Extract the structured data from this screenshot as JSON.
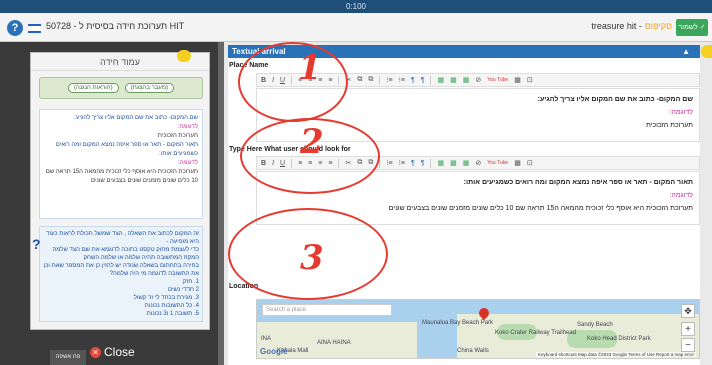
{
  "topbar": {
    "label": "0:100"
  },
  "header": {
    "title": "HIT תערוכת חידה בסיסית ל - 50728",
    "right_text": "treasure hit -",
    "right_accent": "סקיפוס",
    "save_button": "לשמור ✓"
  },
  "left_panel": {
    "card_title": "עמוד חידה",
    "pills": [
      "(הוראות הנגנה)",
      "(מעבר בהצגת)"
    ],
    "blue_lines": [
      {
        "text": "שם המקום- כתוב את שם המקום אליו צריך להגיע:",
        "style": "blue"
      },
      {
        "text": "לדוגמה:",
        "style": "pink"
      },
      {
        "text": "תערוכת הזכוכית",
        "style": "black"
      },
      {
        "text": "תאור המקום - תאר או ספר איפה נמצא המקום ומה רואים כשמגיעים אותו:",
        "style": "blue"
      },
      {
        "text": "לדוגמה:",
        "style": "pink"
      },
      {
        "text": "תערוכת הזכוכית היא אוסף כלי זכוכית מהמאה ה15 תראה שם 10 כלים שונים מזמנים שונים בצבעים שונים",
        "style": "black"
      }
    ],
    "question_lines": [
      "זה המקום לכתוב את השאלה , הצד שמשל תכולת לראות כעוד היא מופיעה -",
      "כדי לעצמת מחוק טקסט בתוכה לדוגמא את שם הצד שלמה המקזז המתשובה תהיה שלמה או שלמה השחק",
      "בחירה בתחתום בשאלה שנודה יש להזין כן את המספר שאת וכן את התשובה לדוגמה מי היה שלמה?",
      "1. חזק",
      "2 חדדי נשים",
      "3. מגירת בכחד לי זר קשול",
      "4. כל התשובות נכונות",
      "5. תשובה 1 ו3 נכונות"
    ],
    "close_label": "Close",
    "bottom_tab": "פח אשפה"
  },
  "section": {
    "title": "Textual arrival",
    "place_name_label": "Place Name",
    "place_name_lines": [
      {
        "text": "שם המקום- כתוב את שם המקום אליו צריך להגיע:",
        "style": "b"
      },
      {
        "text": "לדוגמה:",
        "style": "pink"
      },
      {
        "text": "תערוכת הזכוכית",
        "style": ""
      }
    ],
    "look_for_label": "Type Here What user should look for",
    "look_for_lines": [
      {
        "text": "תאור המקום - תאר או ספר איפה נמצא המקום ומה רואים כשמגיעים אותו:",
        "style": "b"
      },
      {
        "text": "לדוגמה:",
        "style": "pink"
      },
      {
        "text": "תערוכת הזכוכית היא אוסף כלי זכוכית מהמאה ה15 תראה שם 10 כלים שונים מזמנים שונים בצבעים שונים",
        "style": ""
      }
    ],
    "location_label": "Location"
  },
  "toolbar_buttons": [
    "B",
    "I",
    "U",
    "≡",
    "≡",
    "≡",
    "≡",
    "✂",
    "⧉",
    "⧉",
    "⁝≡",
    "⁝≡",
    "¶",
    "¶",
    "▦",
    "▦",
    "▦",
    "⊘",
    "You Tube",
    "▦",
    "⊡"
  ],
  "map": {
    "search_placeholder": "Search a place",
    "labels": [
      "Maunalua Bay Beach Park",
      "Sandy Beach",
      "AINA HAINA",
      "Kahala Mall",
      "Koko Crater Railway Trailhead",
      "Koko Head District Park",
      "China Walls",
      "WAIALAE KAHALA",
      "INA"
    ],
    "footer": "Keyboard shortcuts   Map data ©2023 Google   Terms of Use   Report a map error",
    "logo": "Google"
  },
  "annotations": [
    "1",
    "2",
    "3"
  ],
  "colors": {
    "accent_blue": "#2a72b8",
    "annotation_red": "#e63a30",
    "save_green": "#3aa65c"
  }
}
